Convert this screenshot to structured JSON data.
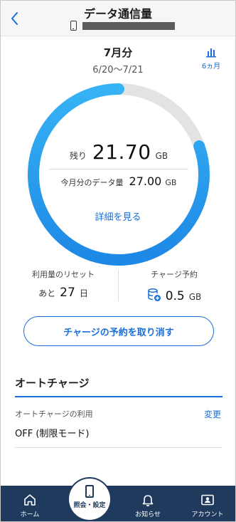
{
  "header": {
    "title": "データ通信量",
    "back_icon": "chevron-left-icon"
  },
  "period": {
    "month": "7月分",
    "range": "6/20〜7/21",
    "history_label": "6ヵ月"
  },
  "usage": {
    "remaining_label": "残り",
    "remaining_value": "21.70",
    "remaining_unit": "GB",
    "monthly_label": "今月分のデータ量",
    "monthly_value": "27.00",
    "monthly_unit": "GB",
    "remaining_fraction": 0.804,
    "detail_link": "詳細を見る"
  },
  "reset": {
    "label": "利用量のリセット",
    "prefix": "あと",
    "value": "27",
    "unit": "日"
  },
  "charge": {
    "label": "チャージ予約",
    "value": "0.5",
    "unit": "GB"
  },
  "cancel_button": "チャージの予約を取り消す",
  "auto_charge": {
    "title": "オートチャージ",
    "use_label": "オートチャージの利用",
    "change_link": "変更",
    "value": "OFF (制限モード)"
  },
  "colors": {
    "accent": "#1a6fd8",
    "arc_start": "#36b3f5",
    "arc_end": "#1e88e5",
    "track": "#e3e3e3",
    "tabbar": "#1f3a5c"
  },
  "tabs": [
    {
      "label": "ホーム",
      "icon": "home-icon"
    },
    {
      "label": "照会・設定",
      "icon": "smartphone-icon"
    },
    {
      "label": "お知らせ",
      "icon": "bell-icon"
    },
    {
      "label": "アカウント",
      "icon": "account-card-icon"
    }
  ]
}
